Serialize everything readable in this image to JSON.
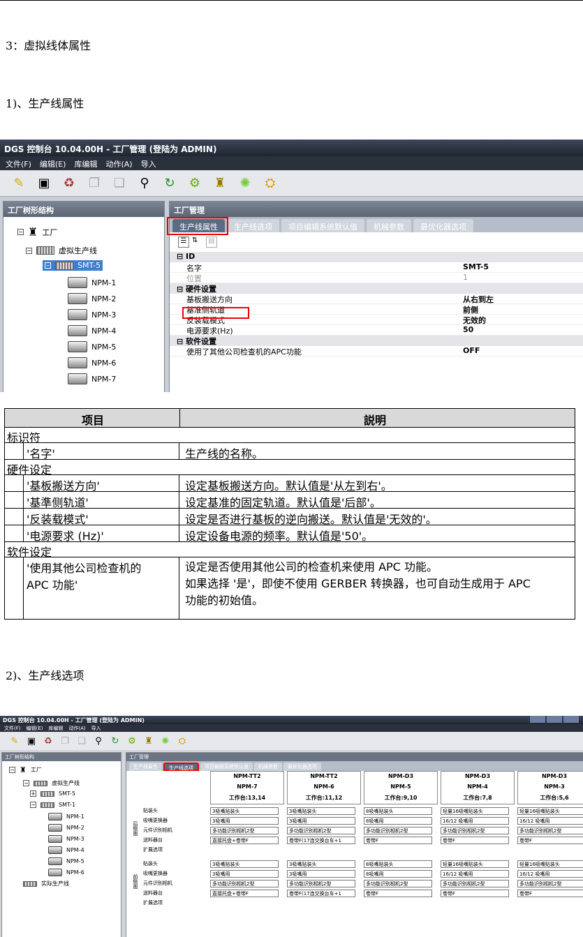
{
  "heading3": "3：虚拟线体属性",
  "heading1": "1)、生产线属性",
  "heading2": "2)、生产线选项",
  "app": {
    "title": "DGS 控制台 10.04.00H - 工厂管理 (登陆为 ADMIN)",
    "menu": [
      "文件(F)",
      "编辑(E)",
      "库编辑",
      "动作(A)",
      "导入"
    ],
    "left_header": "工厂树形结构",
    "right_header": "工厂管理",
    "tabs": [
      "生产线属性",
      "生产线选项",
      "项目编辑系统默认值",
      "机械参数",
      "最优化器选项"
    ],
    "tree": [
      "工厂",
      "虚拟生产线",
      "SMT-5",
      "NPM-1",
      "NPM-2",
      "NPM-3",
      "NPM-4",
      "NPM-5",
      "NPM-6",
      "NPM-7"
    ],
    "props": {
      "id_section": "ID",
      "name_key": "名字",
      "name_val": "SMT-5",
      "pos_key": "位置",
      "pos_val": "1",
      "hw_section": "硬件设置",
      "dir_key": "基板搬送方向",
      "dir_val": "从右到左",
      "rail_key": "基准侧轨道",
      "rail_val": "前侧",
      "rev_key": "反装载模式",
      "rev_val": "无效的",
      "power_key": "电源要求(Hz)",
      "power_val": "50",
      "sw_section": "软件设置",
      "apc_key": "使用了其他公司检查机的APC功能",
      "apc_val": "OFF"
    }
  },
  "table": {
    "head_item": "项目",
    "head_desc": "説明",
    "sec_id": "标识符",
    "r1_item": "'名字'",
    "r1_desc": "生产线的名称。",
    "sec_hw": "硬件设定",
    "r2_item": "'基板搬送方向'",
    "r2_desc": "设定基板搬送方向。默认值是'从左到右'。",
    "r3_item": "'基準侧轨道'",
    "r3_desc": "设定基准的固定轨道。默认值是'后部'。",
    "r4_item": "'反装载模式'",
    "r4_desc": "设定是否进行基板的逆向搬送。默认值是'无效的'。",
    "r5_item": "'电源要求 (Hz)'",
    "r5_desc": "设定设备电源的频率。默认值是'50'。",
    "sec_sw": "软件设定",
    "r6_item_a": "'使用其他公司检查机的",
    "r6_item_b": "APC 功能'",
    "r6_desc_a": "设定是否使用其他公司的检查机来使用 APC 功能。",
    "r6_desc_b": "如果选择 '是'，即使不使用 GERBER 转换器，也可自动生成用于 APC",
    "r6_desc_c": "功能的初始值。"
  },
  "app2": {
    "title": "DGS 控制台 10.04.00H - 工厂管理 (登陆为 ADMIN)",
    "menu": [
      "文件(F)",
      "编辑(E)",
      "库编辑",
      "动作(A)",
      "导入"
    ],
    "left_header": "工厂树形结构",
    "right_header": "工厂管理",
    "tabs": [
      "生产线属性",
      "生产线选项",
      "项目编辑系统默认值",
      "机械参数",
      "最优化器选项"
    ],
    "tree": [
      "工厂",
      "虚拟生产线",
      "SMT-5",
      "SMT-1",
      "NPM-1",
      "NPM-2",
      "NPM-3",
      "NPM-4",
      "NPM-5",
      "NPM-6",
      "实际生产线"
    ],
    "columns": [
      {
        "model": "NPM-TT2",
        "name": "NPM-7",
        "stage": "工作台:13,14"
      },
      {
        "model": "NPM-TT2",
        "name": "NPM-6",
        "stage": "工作台:11,12"
      },
      {
        "model": "NPM-D3",
        "name": "NPM-5",
        "stage": "工作台:9,10"
      },
      {
        "model": "NPM-D3",
        "name": "NPM-4",
        "stage": "工作台:7,8"
      },
      {
        "model": "NPM-D3",
        "name": "NPM-3",
        "stage": "工作台:5,6"
      }
    ],
    "group_rear": "后侧面",
    "group_front": "前侧面",
    "rows": [
      "贴装头",
      "吸嘴更换器",
      "元件识别相机",
      "送料器台",
      "扩展选项"
    ],
    "cells": [
      [
        "3吸嘴贴装头",
        "3吸嘴用",
        "多功能识别相机2型",
        "直接托盘+卷带F"
      ],
      [
        "3吸嘴贴装头",
        "3吸嘴用",
        "多功能识别相机2型",
        "卷带F(17连交换台车+1"
      ],
      [
        "8吸嘴贴装头",
        "8吸嘴用",
        "多功能识别相机2型",
        "卷带F"
      ],
      [
        "轻量16吸嘴贴装头",
        "16/12 吸嘴用",
        "多功能识别相机2型",
        "卷带F"
      ],
      [
        "轻量16吸嘴贴装头",
        "16/12 吸嘴用",
        "多功能识别相机2型",
        "卷带F"
      ]
    ]
  }
}
